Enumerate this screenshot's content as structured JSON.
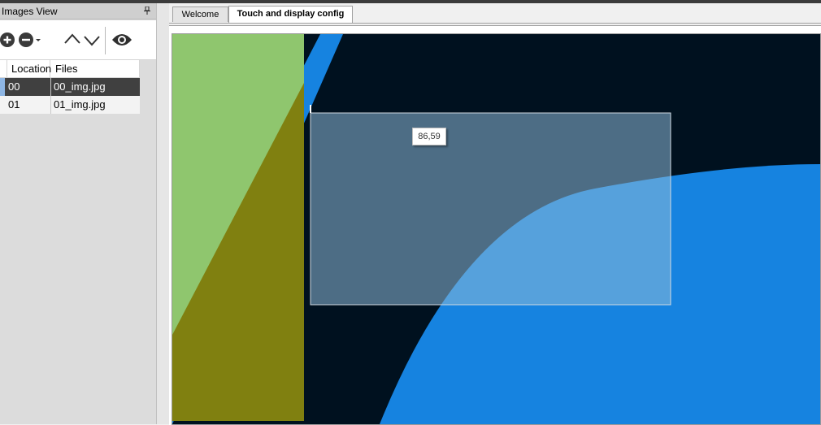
{
  "dock": {
    "title": "Images View",
    "toolbar": {
      "add": "add-circle-icon",
      "remove": "remove-circle-icon",
      "up": "chevron-up-icon",
      "down": "chevron-down-icon",
      "view": "eye-icon"
    },
    "table": {
      "headers": [
        "Location",
        "Files"
      ],
      "rows": [
        {
          "location": "00",
          "file": "00_img.jpg",
          "selected": true
        },
        {
          "location": "01",
          "file": "01_img.jpg",
          "selected": false
        }
      ]
    }
  },
  "tabs": [
    {
      "label": "Welcome",
      "active": false
    },
    {
      "label": "Touch and display config",
      "active": true
    }
  ],
  "canvas": {
    "cursor_readout": "86,59",
    "colors": {
      "background": "#00111f",
      "accent_blue": "#1683e0",
      "touch_region": "#8fc66e",
      "touch_region_overlap": "#808010",
      "display_region": "#5f8fae"
    }
  }
}
